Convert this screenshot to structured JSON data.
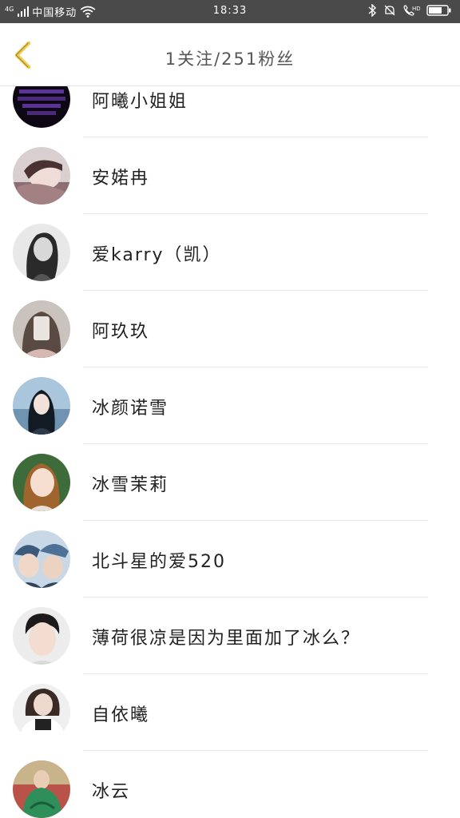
{
  "status_bar": {
    "signal_label": "4G",
    "carrier": "中国移动",
    "time": "18:33",
    "icons": [
      "signal-icon",
      "wifi-icon",
      "bluetooth-icon",
      "mute-icon",
      "hd-call-icon",
      "battery-icon"
    ]
  },
  "header": {
    "title": "1关注/251粉丝",
    "back_icon": "chevron-left-icon",
    "accent_color": "#f2c94c"
  },
  "users": [
    {
      "name": "阿曦小姐姐",
      "avatar": "dark-text-avatar"
    },
    {
      "name": "安婼冉",
      "avatar": "girl-lying-avatar"
    },
    {
      "name": "爱karry（凯）",
      "avatar": "girl-bw-avatar"
    },
    {
      "name": "阿玖玖",
      "avatar": "girl-phone-avatar"
    },
    {
      "name": "冰颜诺雪",
      "avatar": "girl-sea-avatar"
    },
    {
      "name": "冰雪茉莉",
      "avatar": "girl-green-avatar"
    },
    {
      "name": "北斗星的爱520",
      "avatar": "two-boys-avatar"
    },
    {
      "name": "薄荷很凉是因为里面加了冰么？",
      "avatar": "boy-portrait-avatar"
    },
    {
      "name": "自依曦",
      "avatar": "girl-white-avatar"
    },
    {
      "name": "冰云",
      "avatar": "green-art-avatar"
    }
  ]
}
